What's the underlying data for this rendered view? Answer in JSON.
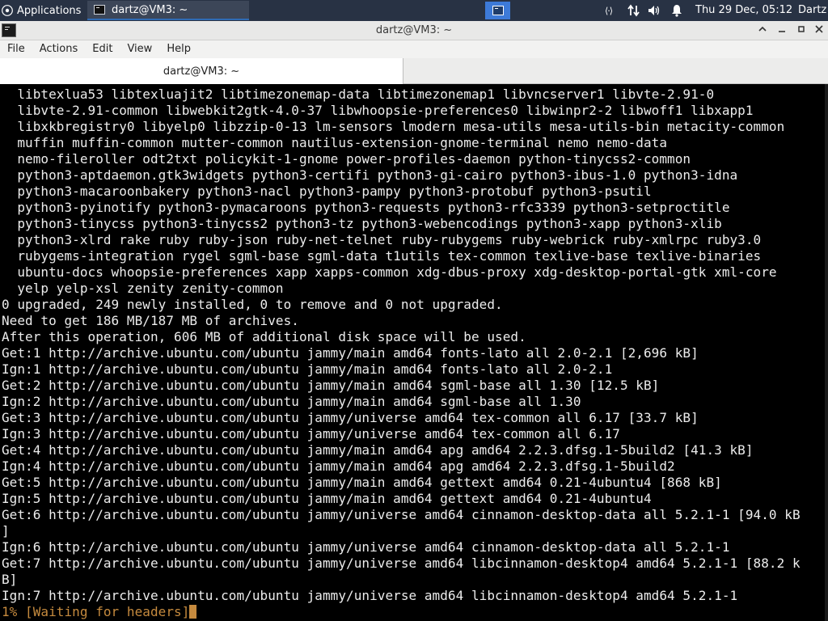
{
  "panel": {
    "applications_label": "Applications",
    "task_label": "dartz@VM3: ~",
    "clock": "Thu 29 Dec, 05:12",
    "user": "Dartz",
    "net_glyph": "⟨·⟩"
  },
  "window": {
    "title": "dartz@VM3: ~",
    "minimize": "‸",
    "restore": "−",
    "maximize": "□",
    "close": "✕"
  },
  "menubar": {
    "file": "File",
    "actions": "Actions",
    "edit": "Edit",
    "view": "View",
    "help": "Help"
  },
  "tab": {
    "label": "dartz@VM3: ~"
  },
  "terminal": {
    "lines": [
      "  libtexlua53 libtexluajit2 libtimezonemap-data libtimezonemap1 libvncserver1 libvte-2.91-0",
      "  libvte-2.91-common libwebkit2gtk-4.0-37 libwhoopsie-preferences0 libwinpr2-2 libwoff1 libxapp1",
      "  libxkbregistry0 libyelp0 libzzip-0-13 lm-sensors lmodern mesa-utils mesa-utils-bin metacity-common",
      "  muffin muffin-common mutter-common nautilus-extension-gnome-terminal nemo nemo-data",
      "  nemo-fileroller odt2txt policykit-1-gnome power-profiles-daemon python-tinycss2-common",
      "  python3-aptdaemon.gtk3widgets python3-certifi python3-gi-cairo python3-ibus-1.0 python3-idna",
      "  python3-macaroonbakery python3-nacl python3-pampy python3-protobuf python3-psutil",
      "  python3-pyinotify python3-pymacaroons python3-requests python3-rfc3339 python3-setproctitle",
      "  python3-tinycss python3-tinycss2 python3-tz python3-webencodings python3-xapp python3-xlib",
      "  python3-xlrd rake ruby ruby-json ruby-net-telnet ruby-rubygems ruby-webrick ruby-xmlrpc ruby3.0",
      "  rubygems-integration rygel sgml-base sgml-data t1utils tex-common texlive-base texlive-binaries",
      "  ubuntu-docs whoopsie-preferences xapp xapps-common xdg-dbus-proxy xdg-desktop-portal-gtk xml-core",
      "  yelp yelp-xsl zenity zenity-common",
      "0 upgraded, 249 newly installed, 0 to remove and 0 not upgraded.",
      "Need to get 186 MB/187 MB of archives.",
      "After this operation, 606 MB of additional disk space will be used.",
      "Get:1 http://archive.ubuntu.com/ubuntu jammy/main amd64 fonts-lato all 2.0-2.1 [2,696 kB]",
      "Ign:1 http://archive.ubuntu.com/ubuntu jammy/main amd64 fonts-lato all 2.0-2.1",
      "Get:2 http://archive.ubuntu.com/ubuntu jammy/main amd64 sgml-base all 1.30 [12.5 kB]",
      "Ign:2 http://archive.ubuntu.com/ubuntu jammy/main amd64 sgml-base all 1.30",
      "Get:3 http://archive.ubuntu.com/ubuntu jammy/universe amd64 tex-common all 6.17 [33.7 kB]",
      "Ign:3 http://archive.ubuntu.com/ubuntu jammy/universe amd64 tex-common all 6.17",
      "Get:4 http://archive.ubuntu.com/ubuntu jammy/main amd64 apg amd64 2.2.3.dfsg.1-5build2 [41.3 kB]",
      "Ign:4 http://archive.ubuntu.com/ubuntu jammy/main amd64 apg amd64 2.2.3.dfsg.1-5build2",
      "Get:5 http://archive.ubuntu.com/ubuntu jammy/main amd64 gettext amd64 0.21-4ubuntu4 [868 kB]",
      "Ign:5 http://archive.ubuntu.com/ubuntu jammy/main amd64 gettext amd64 0.21-4ubuntu4",
      "Get:6 http://archive.ubuntu.com/ubuntu jammy/universe amd64 cinnamon-desktop-data all 5.2.1-1 [94.0 kB",
      "]",
      "Ign:6 http://archive.ubuntu.com/ubuntu jammy/universe amd64 cinnamon-desktop-data all 5.2.1-1",
      "Get:7 http://archive.ubuntu.com/ubuntu jammy/universe amd64 libcinnamon-desktop4 amd64 5.2.1-1 [88.2 k",
      "B]",
      "Ign:7 http://archive.ubuntu.com/ubuntu jammy/universe amd64 libcinnamon-desktop4 amd64 5.2.1-1"
    ],
    "status_line": "1% [Waiting for headers]",
    "accent_color": "#c58a3e"
  }
}
